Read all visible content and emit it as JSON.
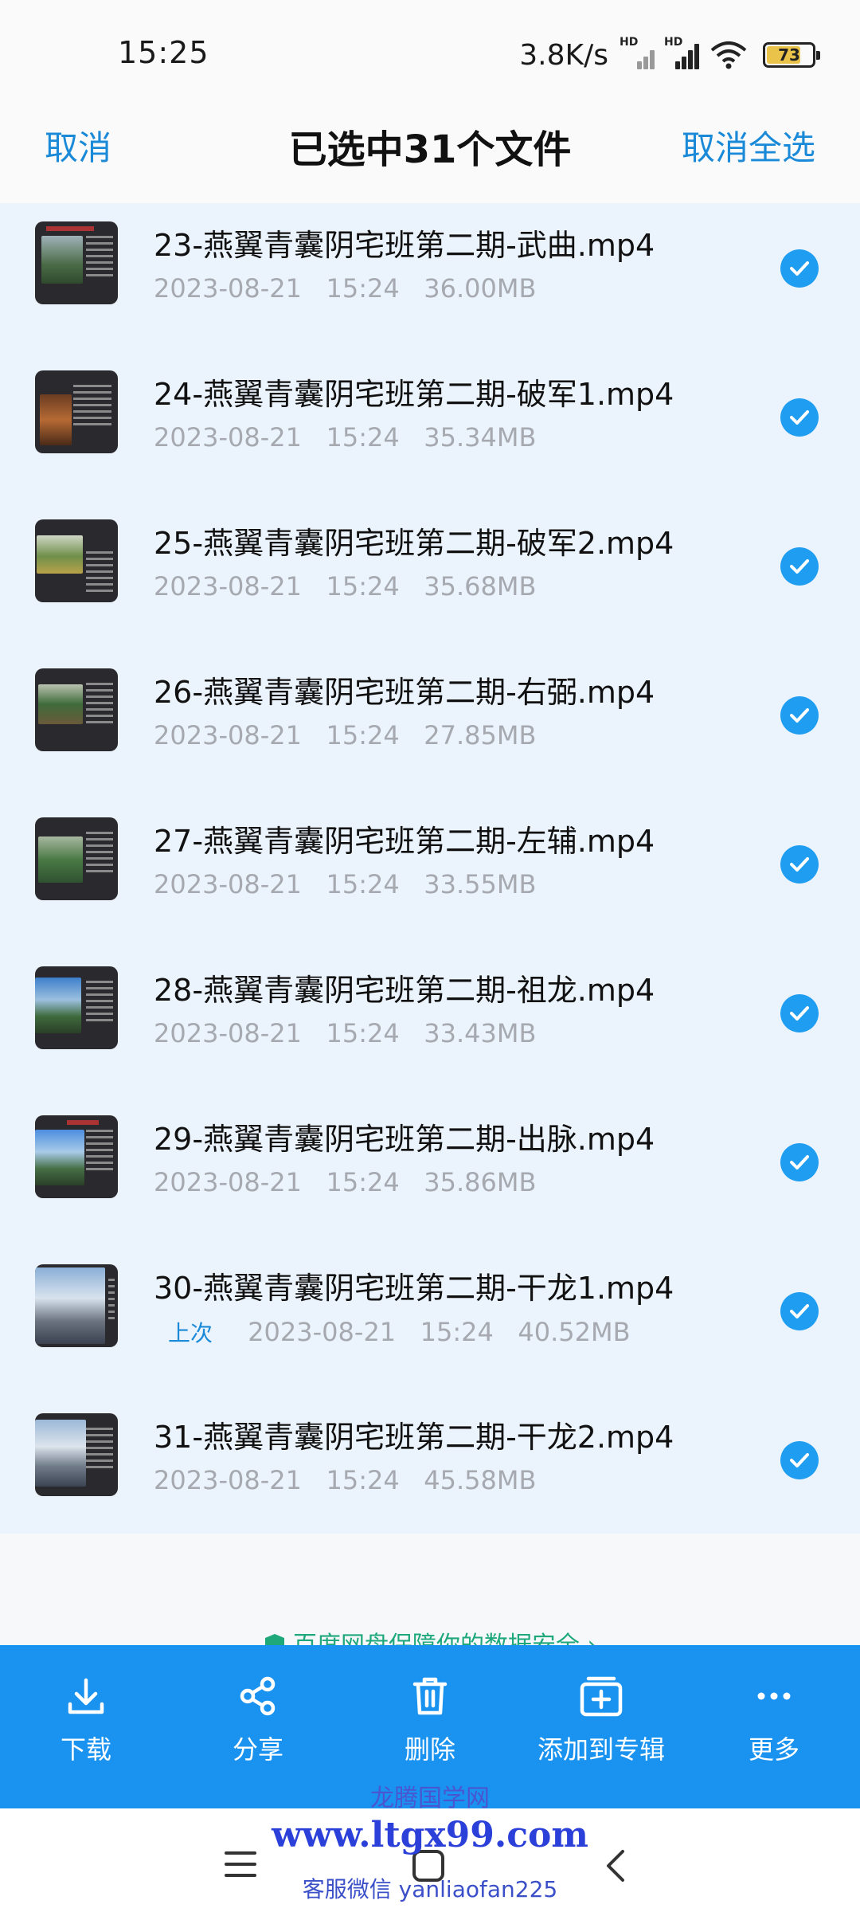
{
  "status_bar": {
    "time": "15:25",
    "net_speed": "3.8K/s",
    "sim1_label": "HD",
    "sim2_label": "HD",
    "battery": "73",
    "battery_level": 0.73,
    "icons": [
      "signal-hd-icon",
      "signal-hd-icon",
      "wifi-icon",
      "battery-icon"
    ]
  },
  "header": {
    "cancel": "取消",
    "title": "已选中31个文件",
    "cancel_all": "取消全选"
  },
  "files": [
    {
      "name": "23-燕翼青囊阴宅班第二期-武曲.mp4",
      "date": "2023-08-21",
      "time": "15:24",
      "size": "36.00MB",
      "badge": ""
    },
    {
      "name": "24-燕翼青囊阴宅班第二期-破军1.mp4",
      "date": "2023-08-21",
      "time": "15:24",
      "size": "35.34MB",
      "badge": ""
    },
    {
      "name": "25-燕翼青囊阴宅班第二期-破军2.mp4",
      "date": "2023-08-21",
      "time": "15:24",
      "size": "35.68MB",
      "badge": ""
    },
    {
      "name": "26-燕翼青囊阴宅班第二期-右弼.mp4",
      "date": "2023-08-21",
      "time": "15:24",
      "size": "27.85MB",
      "badge": ""
    },
    {
      "name": "27-燕翼青囊阴宅班第二期-左辅.mp4",
      "date": "2023-08-21",
      "time": "15:24",
      "size": "33.55MB",
      "badge": ""
    },
    {
      "name": "28-燕翼青囊阴宅班第二期-祖龙.mp4",
      "date": "2023-08-21",
      "time": "15:24",
      "size": "33.43MB",
      "badge": ""
    },
    {
      "name": "29-燕翼青囊阴宅班第二期-出脉.mp4",
      "date": "2023-08-21",
      "time": "15:24",
      "size": "35.86MB",
      "badge": ""
    },
    {
      "name": "30-燕翼青囊阴宅班第二期-干龙1.mp4",
      "date": "2023-08-21",
      "time": "15:24",
      "size": "40.52MB",
      "badge": "上次"
    },
    {
      "name": "31-燕翼青囊阴宅班第二期-干龙2.mp4",
      "date": "2023-08-21",
      "time": "15:24",
      "size": "45.58MB",
      "badge": ""
    }
  ],
  "safety_banner": "百度网盘保障你的数据安全 ›",
  "actions": [
    {
      "label": "下载",
      "icon": "download-icon"
    },
    {
      "label": "分享",
      "icon": "share-icon"
    },
    {
      "label": "删除",
      "icon": "trash-icon"
    },
    {
      "label": "添加到专辑",
      "icon": "add-to-album-icon"
    },
    {
      "label": "更多",
      "icon": "more-icon"
    }
  ],
  "watermark": {
    "site_name": "龙腾国学网",
    "url": "www.ltgx99.com",
    "contact": "客服微信 yanliaofan225"
  },
  "colors": {
    "accent": "#1a8ad8",
    "action_bar": "#1a93f0",
    "check": "#1e9df1",
    "list_bg": "#ebf3fc",
    "meta_text": "#a6aab0"
  }
}
